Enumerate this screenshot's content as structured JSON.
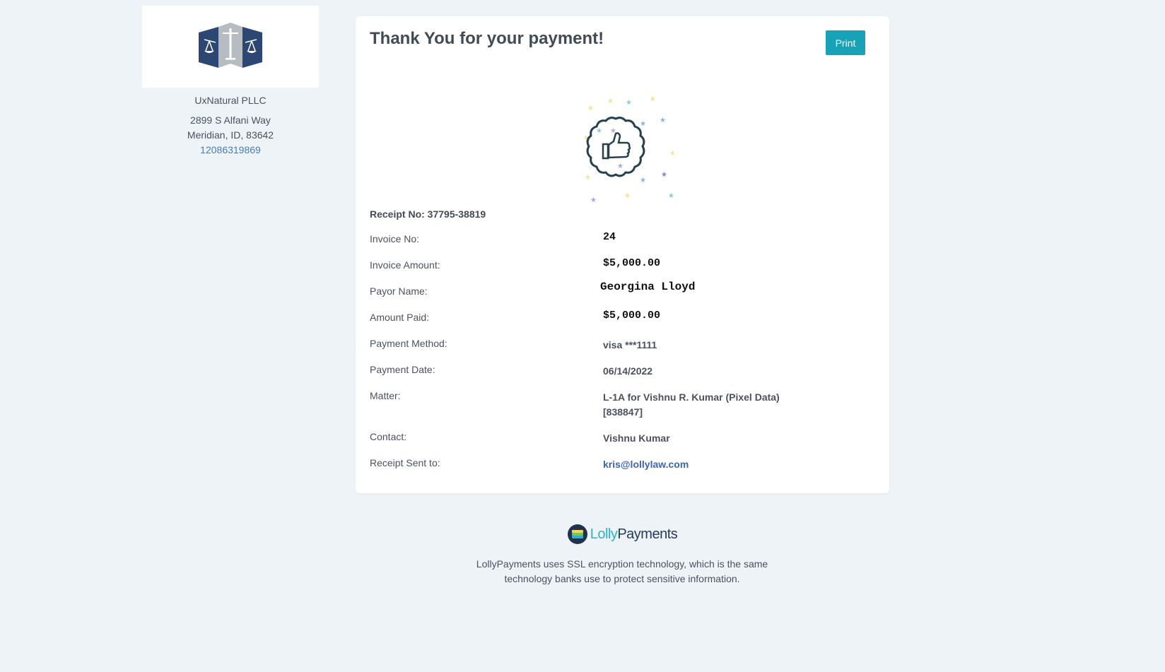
{
  "firm": {
    "name": "UxNatural PLLC",
    "address_line1": "2899 S Alfani Way",
    "address_line2": "Meridian, ID, 83642",
    "phone": "12086319869"
  },
  "card": {
    "title": "Thank You for your payment!",
    "print_label": "Print",
    "receipt_no": "Receipt No: 37795-38819",
    "rows": [
      {
        "label": "Invoice No:",
        "value": "24"
      },
      {
        "label": "Invoice Amount:",
        "value": "$5,000.00"
      },
      {
        "label": "Payor Name:",
        "value": "Georgina Lloyd"
      },
      {
        "label": "Amount Paid:",
        "value": "$5,000.00"
      },
      {
        "label": "Payment Method:",
        "value": "visa ***1111"
      },
      {
        "label": "Payment Date:",
        "value": "06/14/2022"
      },
      {
        "label": "Matter:",
        "value": "L-1A for Vishnu R. Kumar (Pixel Data) [838847]"
      },
      {
        "label": "Contact:",
        "value": "Vishnu Kumar"
      },
      {
        "label": "Receipt Sent to:",
        "value": "kris@lollylaw.com"
      }
    ]
  },
  "footer": {
    "brand_part1": "Lolly",
    "brand_part2": "Payments",
    "text": "LollyPayments uses SSL encryption technology, which is the same technology banks use to protect sensitive information."
  },
  "colors": {
    "background": "#edf3f6",
    "print_button": "#17a2b8",
    "link": "#3b66b0",
    "firm_logo": "#2c4773",
    "badge": "#27414e"
  },
  "icons": {
    "firm_logo": "scales-of-justice-logo",
    "badge": "thumbs-up-badge-icon",
    "brand": "lollypayments-logo-icon"
  }
}
